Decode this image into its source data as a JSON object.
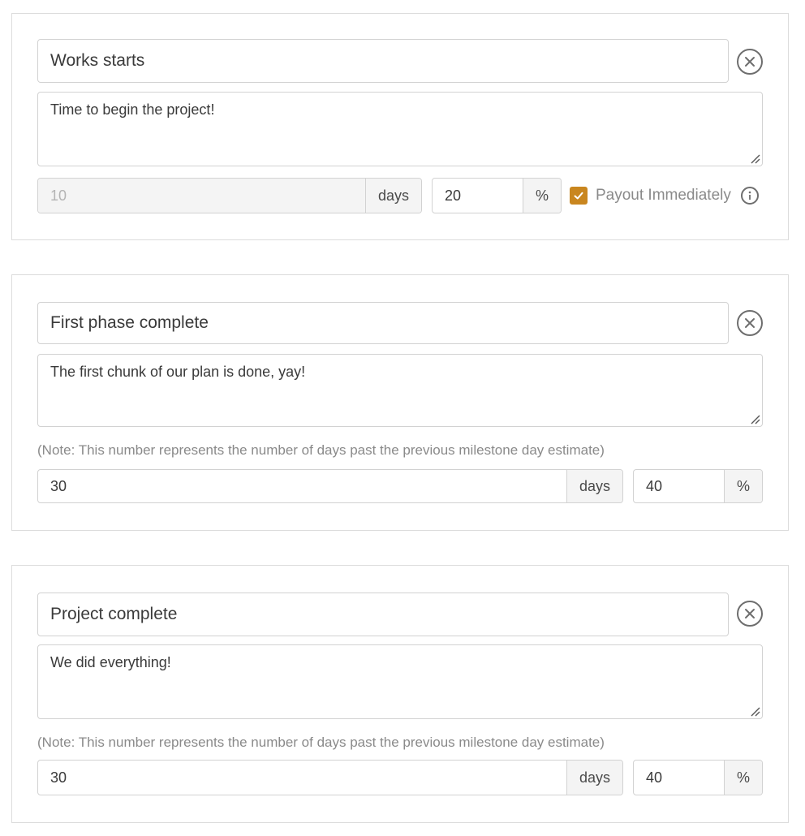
{
  "milestones": [
    {
      "title": "Works starts",
      "description": "Time to begin the project!",
      "days_value": "10",
      "days_unit": "days",
      "percent_value": "20",
      "percent_unit": "%",
      "payout_label": "Payout Immediately",
      "payout_checked": true
    },
    {
      "title": "First phase complete",
      "description": "The first chunk of our plan is done, yay!",
      "note": "(Note: This number represents the number of days past the previous milestone day estimate)",
      "days_value": "30",
      "days_unit": "days",
      "percent_value": "40",
      "percent_unit": "%"
    },
    {
      "title": "Project complete",
      "description": "We did everything!",
      "note": "(Note: This number represents the number of days past the previous milestone day estimate)",
      "days_value": "30",
      "days_unit": "days",
      "percent_value": "40",
      "percent_unit": "%"
    }
  ],
  "icons": {
    "remove": "close-circle-icon",
    "info": "info-circle-icon",
    "check": "check-icon",
    "resize": "resize-handle-icon"
  },
  "colors": {
    "accent": "#c9861f",
    "border": "#d2d2d2",
    "addon_bg": "#f4f4f4",
    "muted_text": "#8a8a8a"
  }
}
